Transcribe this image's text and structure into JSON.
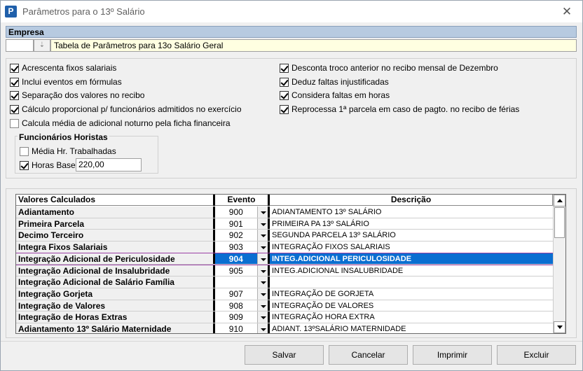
{
  "window": {
    "title": "Parâmetros para o 13º Salário",
    "app_icon_letter": "P",
    "close_glyph": "✕"
  },
  "empresa": {
    "label": "Empresa",
    "code": "",
    "name": "Tabela de Parâmetros para 13o Salário Geral"
  },
  "options_left": [
    {
      "label": "Acrescenta fixos salariais",
      "checked": true
    },
    {
      "label": "Inclui eventos em fórmulas",
      "checked": true
    },
    {
      "label": "Separação dos valores no recibo",
      "checked": true
    },
    {
      "label": "Cálculo proporcional p/ funcionários admitidos no exercício",
      "checked": true
    },
    {
      "label": "Calcula média de adicional noturno pela ficha financeira",
      "checked": false
    }
  ],
  "options_right": [
    {
      "label": "Desconta troco anterior no recibo mensal de Dezembro",
      "checked": true
    },
    {
      "label": "Deduz faltas injustificadas",
      "checked": true
    },
    {
      "label": "Considera faltas em horas",
      "checked": true
    },
    {
      "label": "Reprocessa 1ª parcela em caso de pagto. no recibo de férias",
      "checked": true
    }
  ],
  "horistas": {
    "title": "Funcionários Horistas",
    "media_label": "Média Hr. Trabalhadas",
    "media_checked": false,
    "horas_label": "Horas Base",
    "horas_checked": true,
    "horas_value": "220,00"
  },
  "grid": {
    "headers": [
      "Valores Calculados",
      "Evento",
      "Descrição"
    ],
    "rows": [
      {
        "valor": "Adiantamento",
        "evento": "900",
        "descricao": "ADIANTAMENTO 13º SALÁRIO"
      },
      {
        "valor": "Primeira Parcela",
        "evento": "901",
        "descricao": "PRIMEIRA PA 13º SALÁRIO"
      },
      {
        "valor": "Decimo Terceiro",
        "evento": "902",
        "descricao": "SEGUNDA PARCELA 13º SALÁRIO"
      },
      {
        "valor": "Integra Fixos Salariais",
        "evento": "903",
        "descricao": "INTEGRAÇÃO FIXOS SALARIAIS"
      },
      {
        "valor": "Integração Adicional de Periculosidade",
        "evento": "904",
        "descricao": "INTEG.ADICIONAL PERICULOSIDADE",
        "selected": true
      },
      {
        "valor": "Integração Adicional de Insalubridade",
        "evento": "905",
        "descricao": "INTEG.ADICIONAL INSALUBRIDADE"
      },
      {
        "valor": "Integração Adicional de Salário Família",
        "evento": "",
        "descricao": ""
      },
      {
        "valor": "Integração Gorjeta",
        "evento": "907",
        "descricao": "INTEGRAÇÃO DE GORJETA"
      },
      {
        "valor": "Integração de Valores",
        "evento": "908",
        "descricao": "INTEGRAÇÃO DE VALORES"
      },
      {
        "valor": "Integração de Horas Extras",
        "evento": "909",
        "descricao": "INTEGRAÇÃO HORA EXTRA"
      },
      {
        "valor": "Adiantamento 13º Salário Maternidade",
        "evento": "910",
        "descricao": "ADIANT. 13ºSALÁRIO MATERNIDADE"
      }
    ]
  },
  "buttons": {
    "salvar": "Salvar",
    "cancelar": "Cancelar",
    "imprimir": "Imprimir",
    "excluir": "Excluir"
  },
  "colors": {
    "selection": "#0a6ed1",
    "header_bar": "#b7cae0",
    "name_field": "#ffffe1"
  }
}
